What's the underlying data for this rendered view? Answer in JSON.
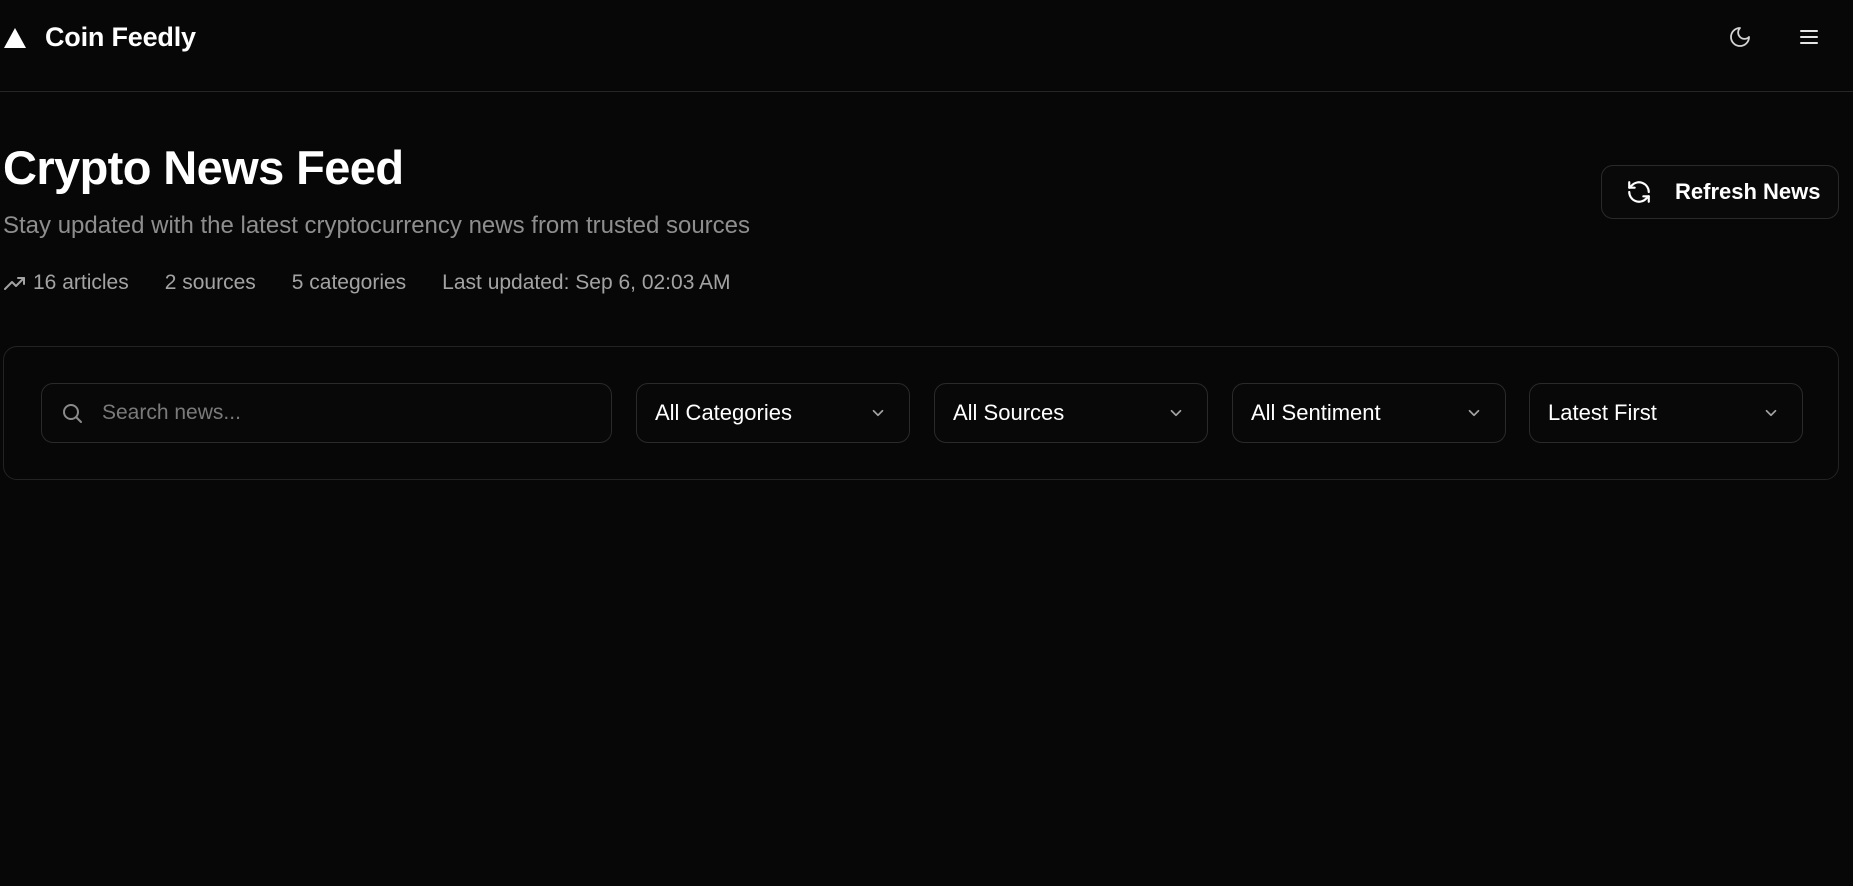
{
  "header": {
    "brand_name": "Coin Feedly",
    "logo_icon": "triangle-logo-icon",
    "theme_toggle_icon": "moon-icon",
    "menu_icon": "hamburger-menu-icon"
  },
  "main": {
    "title": "Crypto News Feed",
    "subtitle": "Stay updated with the latest cryptocurrency news from trusted sources",
    "stats": {
      "icon": "trending-up-icon",
      "articles": "16 articles",
      "sources": "2 sources",
      "categories": "5 categories",
      "last_updated": "Last updated: Sep 6, 02:03 AM"
    },
    "refresh_button": {
      "icon": "refresh-icon",
      "label": "Refresh News"
    }
  },
  "filters": {
    "search": {
      "icon": "search-icon",
      "placeholder": "Search news...",
      "value": ""
    },
    "category_select": "All Categories",
    "source_select": "All Sources",
    "sentiment_select": "All Sentiment",
    "sort_select": "Latest First"
  },
  "colors": {
    "background": "#070707",
    "border": "#262626",
    "text": "#ffffff",
    "muted_text": "#8e8e8e"
  }
}
